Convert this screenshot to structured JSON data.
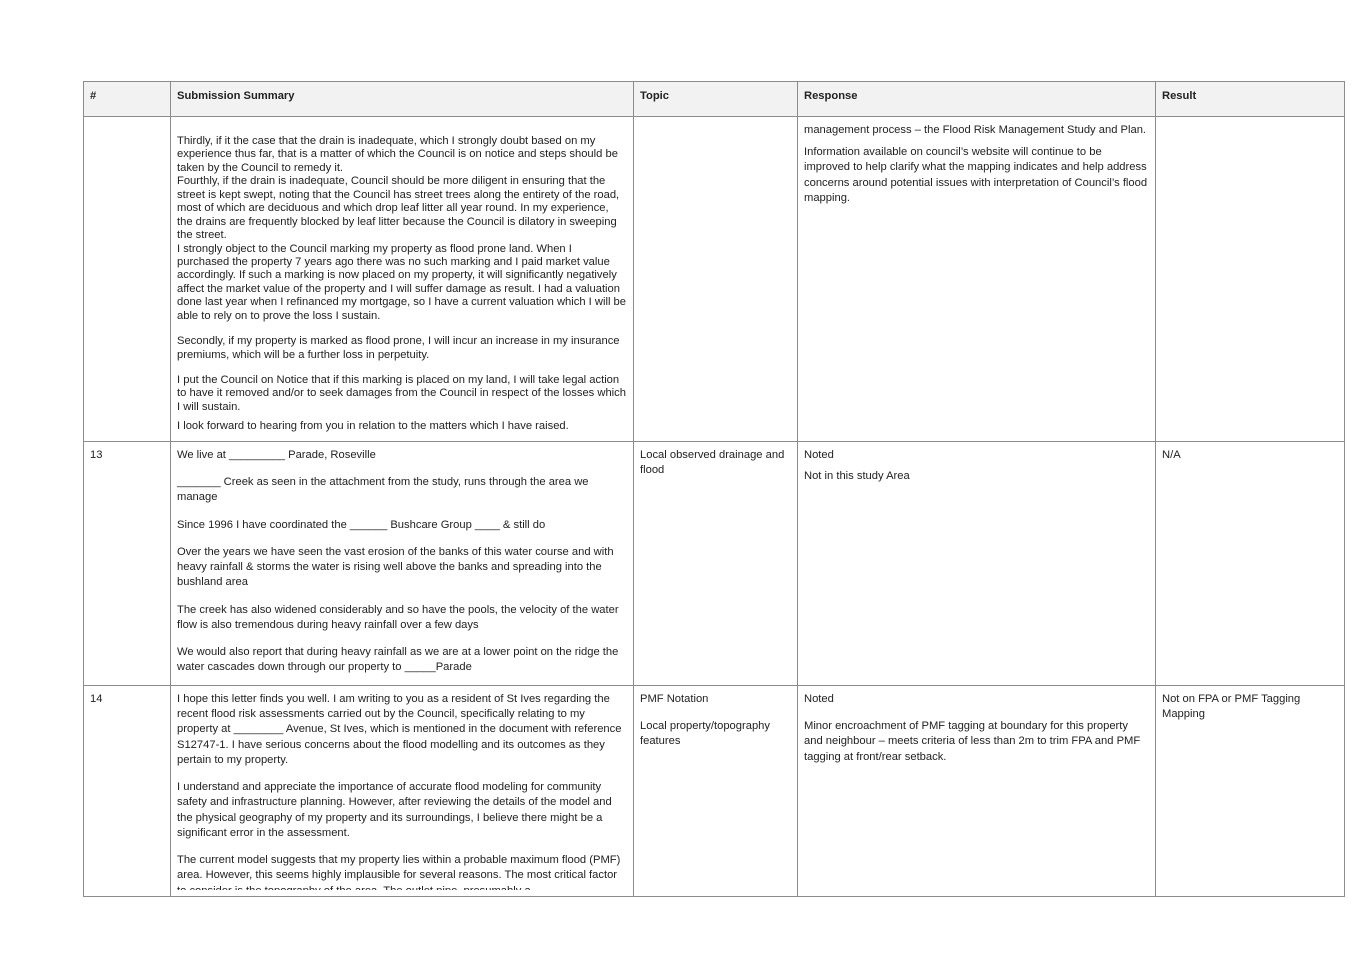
{
  "headers": {
    "num": "#",
    "summary": "Submission Summary",
    "topic": "Topic",
    "response": "Response",
    "result": "Result"
  },
  "rows": [
    {
      "num": "",
      "summary": [
        "Thirdly, if it the case that the drain is inadequate, which I strongly doubt based on my experience thus far, that is a matter of which the Council is on notice and steps should be taken by the Council to remedy it.",
        "Fourthly, if the drain is inadequate, Council should be more diligent in ensuring that the street is kept swept, noting that the Council has street trees along the entirety of the road, most of which are deciduous and which drop leaf litter all year round. In my experience, the drains are frequently blocked by leaf litter because the Council is dilatory in sweeping the street.",
        "I strongly object to the Council marking my property as flood prone land. When I purchased the property 7 years ago there was no such marking and I paid market value accordingly. If such a marking is now placed on my property, it will significantly negatively affect the market value of the property and I will suffer damage as result. I had a valuation done last year when I refinanced my mortgage, so I have a current valuation which I will be able to rely on to prove the loss I sustain.",
        "Secondly, if my property is marked as flood prone, I will incur an increase in my insurance premiums, which will be a further loss in perpetuity.",
        "I put the Council on Notice that if this marking is placed on my land, I will take legal action to have it removed and/or to seek damages from the Council in respect of the losses which I will sustain.",
        "I look forward to hearing from you in relation to the matters which I have raised."
      ],
      "topic": [],
      "response": [
        "management process – the Flood Risk Management Study and Plan.",
        "Information available on council’s website will continue to be improved to help clarify what the mapping indicates and help address concerns around potential issues with interpretation of Council’s flood mapping."
      ],
      "result": ""
    },
    {
      "num": "13",
      "summary": [
        "We live at _________ Parade, Roseville",
        "_______ Creek as seen in the attachment from the study, runs through the area we manage",
        "Since 1996 I have coordinated the ______ Bushcare Group ____ & still do",
        "Over the years we have seen the vast erosion of the banks of this water course and with heavy rainfall & storms the water is rising well above the banks and spreading into the bushland area",
        "The creek has also widened considerably and so have the pools, the velocity of the water flow is also tremendous during heavy rainfall over a few days",
        "We would also report that during heavy rainfall as we are at a lower point on the ridge the water cascades down through our property to _____Parade"
      ],
      "topic": [
        "Local observed drainage and flood"
      ],
      "response": [
        "Noted",
        "Not in this study Area"
      ],
      "result": "N/A"
    },
    {
      "num": "14",
      "summary": [
        "I hope this letter finds you well. I am writing to you as a resident of St Ives regarding the recent flood risk assessments carried out by the Council, specifically relating to my property at ________ Avenue, St Ives, which is mentioned in the document with reference S12747-1. I have serious concerns about the flood modelling and its outcomes as they pertain to my property.",
        "I understand and appreciate the importance of accurate flood modeling for community safety and infrastructure planning. However, after reviewing the details of the model and the physical geography of my property and its surroundings, I believe there might be a significant error in the assessment.",
        "The current model suggests that my property lies within a probable maximum flood (PMF) area. However, this seems highly implausible for several reasons. The most critical factor to consider is the topography of the area. The outlet pipe, presumably a"
      ],
      "topic": [
        "PMF Notation",
        "Local property/topography features"
      ],
      "response": [
        "Noted",
        "Minor encroachment of PMF tagging at boundary for this property and neighbour – meets criteria of less than 2m to trim FPA and PMF tagging at front/rear setback."
      ],
      "result": "Not on FPA or PMF Tagging Mapping"
    }
  ]
}
